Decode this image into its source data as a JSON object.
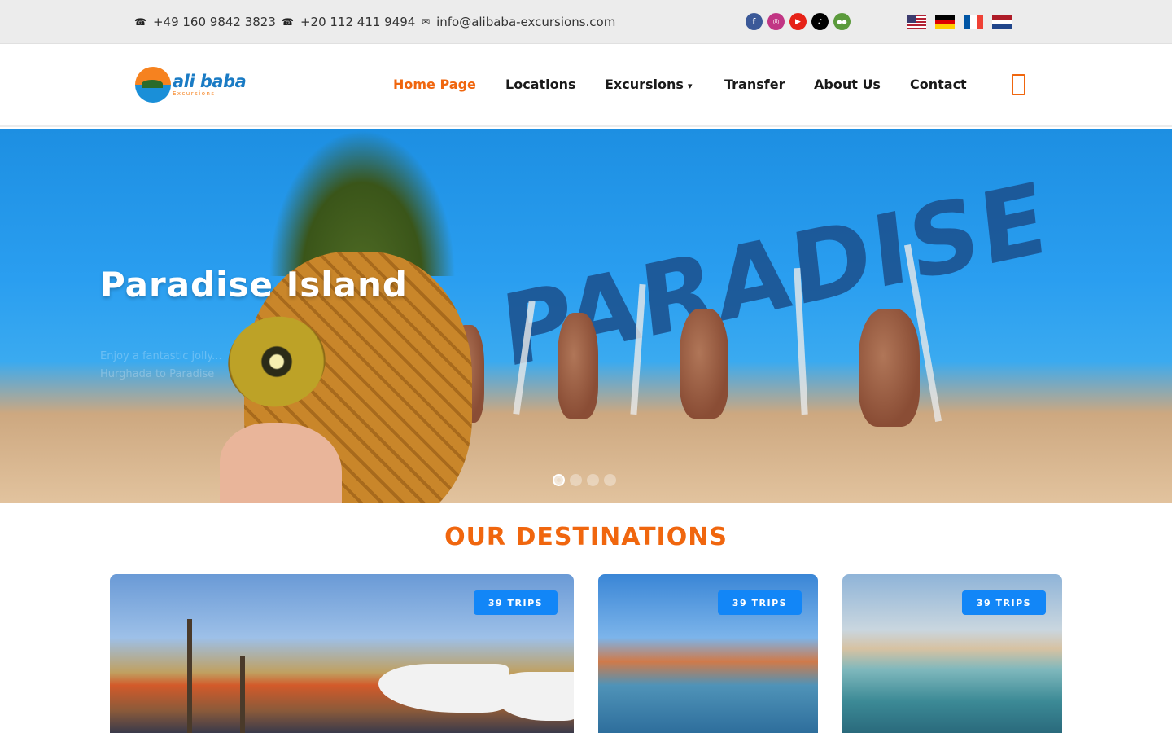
{
  "topbar": {
    "phone1": "+49 160 9842 3823",
    "phone2": "+20 112 411 9494",
    "email": "info@alibaba-excursions.com",
    "phone_icon": "☎",
    "mail_icon": "✉",
    "socials": [
      {
        "name": "facebook",
        "glyph": "f",
        "color": "#3b5998"
      },
      {
        "name": "instagram",
        "glyph": "◎",
        "color": "#c13584"
      },
      {
        "name": "youtube",
        "glyph": "▶",
        "color": "#e62117"
      },
      {
        "name": "tiktok",
        "glyph": "♪",
        "color": "#000000"
      },
      {
        "name": "tripadvisor",
        "glyph": "●●",
        "color": "#5b9a3c"
      }
    ],
    "languages": [
      "English",
      "Deutsch",
      "Français",
      "Nederlands"
    ]
  },
  "header": {
    "logo_main": "ali baba",
    "logo_sub": "Excursions",
    "nav": {
      "home": "Home Page",
      "locations": "Locations",
      "excursions": "Excursions",
      "transfer": "Transfer",
      "about": "About Us",
      "contact": "Contact"
    },
    "caret": "▾",
    "accent_color": "#f0660e"
  },
  "hero": {
    "title": "Paradise Island",
    "text": "Enjoy a fantastic jolly... Hurghada to Paradise",
    "sign_text": "PARADISE",
    "slides": 4,
    "active_slide": 1
  },
  "destinations": {
    "title": "OUR DESTINATIONS",
    "cards": [
      {
        "badge": "39 TRIPS"
      },
      {
        "badge": "39 TRIPS"
      },
      {
        "badge": "39 TRIPS"
      }
    ],
    "badge_color": "#1286f7"
  }
}
